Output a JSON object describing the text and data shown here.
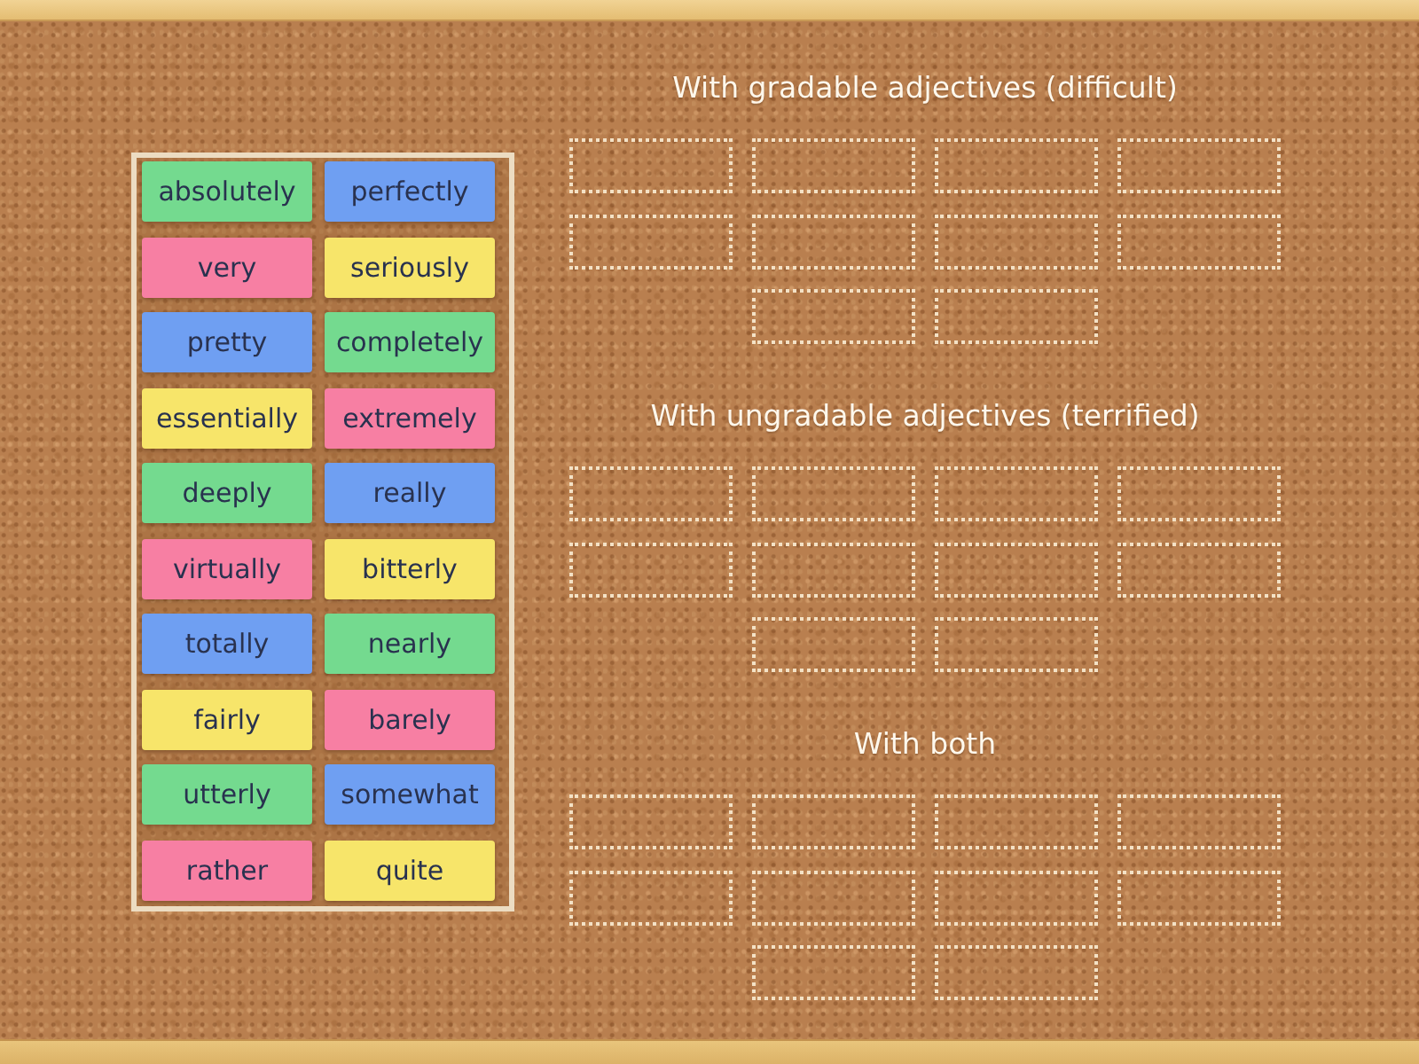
{
  "cards": [
    {
      "text": "absolutely",
      "color": "#74da8f"
    },
    {
      "text": "perfectly",
      "color": "#6f9ff2"
    },
    {
      "text": "very",
      "color": "#f77fa3"
    },
    {
      "text": "seriously",
      "color": "#f7e56a"
    },
    {
      "text": "pretty",
      "color": "#6f9ff2"
    },
    {
      "text": "completely",
      "color": "#74da8f"
    },
    {
      "text": "essentially",
      "color": "#f7e56a"
    },
    {
      "text": "extremely",
      "color": "#f77fa3"
    },
    {
      "text": "deeply",
      "color": "#74da8f"
    },
    {
      "text": "really",
      "color": "#6f9ff2"
    },
    {
      "text": "virtually",
      "color": "#f77fa3"
    },
    {
      "text": "bitterly",
      "color": "#f7e56a"
    },
    {
      "text": "totally",
      "color": "#6f9ff2"
    },
    {
      "text": "nearly",
      "color": "#74da8f"
    },
    {
      "text": "fairly",
      "color": "#f7e56a"
    },
    {
      "text": "barely",
      "color": "#f77fa3"
    },
    {
      "text": "utterly",
      "color": "#74da8f"
    },
    {
      "text": "somewhat",
      "color": "#6f9ff2"
    },
    {
      "text": "rather",
      "color": "#f77fa3"
    },
    {
      "text": "quite",
      "color": "#f7e56a"
    }
  ],
  "groups": [
    {
      "heading": "With gradable adjectives (difficult)",
      "slot_rows": [
        [
          {
            "kind": "empty"
          },
          {
            "kind": "empty"
          },
          {
            "kind": "empty"
          },
          {
            "kind": "empty"
          }
        ],
        [
          {
            "kind": "empty"
          },
          {
            "kind": "empty"
          },
          {
            "kind": "empty"
          },
          {
            "kind": "empty"
          }
        ],
        [
          {
            "kind": "empty"
          },
          {
            "kind": "empty"
          }
        ]
      ]
    },
    {
      "heading": "With ungradable adjectives (terrified)",
      "slot_rows": [
        [
          {
            "kind": "empty"
          },
          {
            "kind": "empty"
          },
          {
            "kind": "empty"
          },
          {
            "kind": "empty"
          }
        ],
        [
          {
            "kind": "empty"
          },
          {
            "kind": "empty"
          },
          {
            "kind": "empty"
          },
          {
            "kind": "empty"
          }
        ],
        [
          {
            "kind": "empty"
          },
          {
            "kind": "empty"
          }
        ]
      ]
    },
    {
      "heading": "With both",
      "slot_rows": [
        [
          {
            "kind": "empty"
          },
          {
            "kind": "empty"
          },
          {
            "kind": "empty"
          },
          {
            "kind": "empty"
          }
        ],
        [
          {
            "kind": "empty"
          },
          {
            "kind": "empty"
          },
          {
            "kind": "empty"
          },
          {
            "kind": "empty"
          }
        ],
        [
          {
            "kind": "empty"
          },
          {
            "kind": "empty"
          }
        ]
      ]
    }
  ]
}
